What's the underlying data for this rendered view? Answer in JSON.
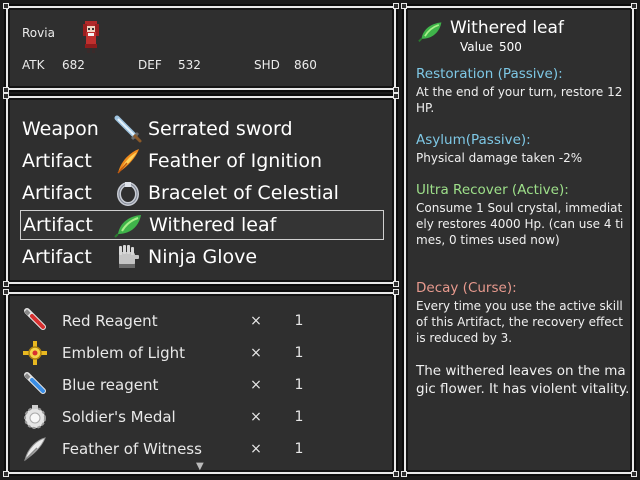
{
  "character": {
    "name": "Rovia",
    "stats": [
      {
        "label": "ATK",
        "value": "682"
      },
      {
        "label": "DEF",
        "value": "532"
      },
      {
        "label": "SHD",
        "value": "860"
      }
    ]
  },
  "equipment": [
    {
      "type": "Weapon",
      "name": "Serrated sword",
      "icon": "sword-icon"
    },
    {
      "type": "Artifact",
      "name": "Feather of Ignition",
      "icon": "flame-feather-icon"
    },
    {
      "type": "Artifact",
      "name": "Bracelet of Celestial",
      "icon": "bracelet-icon"
    },
    {
      "type": "Artifact",
      "name": "Withered leaf",
      "icon": "leaf-icon",
      "selected": true
    },
    {
      "type": "Artifact",
      "name": "Ninja Glove",
      "icon": "glove-icon"
    }
  ],
  "inventory": [
    {
      "name": "Red Reagent",
      "x": "×",
      "qty": "1",
      "icon": "red-vial-icon"
    },
    {
      "name": "Emblem of Light",
      "x": "×",
      "qty": "1",
      "icon": "emblem-icon"
    },
    {
      "name": "Blue reagent",
      "x": "×",
      "qty": "1",
      "icon": "blue-vial-icon"
    },
    {
      "name": "Soldier's Medal",
      "x": "×",
      "qty": "1",
      "icon": "medal-icon"
    },
    {
      "name": "Feather of Witness",
      "x": "×",
      "qty": "1",
      "icon": "white-feather-icon"
    }
  ],
  "detail": {
    "title": "Withered leaf",
    "value_label": "Value",
    "value": "500",
    "sections": [
      {
        "heading": "Restoration (Passive):",
        "color": "#7ec8e6",
        "text": "At the end of your turn, restore 12 HP."
      },
      {
        "heading": "Asylum(Passive):",
        "color": "#7ec8e6",
        "text": "Physical damage taken -2%"
      },
      {
        "heading": "Ultra Recover (Active):",
        "color": "#9ee08a",
        "text": "Consume 1 Soul crystal, immediately restores 4000 Hp. (can use 4 times, 0 times used now)"
      },
      {
        "heading": "Decay (Curse):",
        "color": "#e89a8e",
        "text": "Every time you use the active skill of this Artifact, the recovery effect is reduced by 3."
      }
    ],
    "flavor": "The withered leaves on the magic flower. It has violent vitality."
  },
  "colors": {
    "panel_bg": "#2f2f2f",
    "border": "#e8e8e8",
    "passive_heading": "#7ec8e6",
    "active_heading": "#9ee08a",
    "curse_heading": "#e89a8e"
  }
}
